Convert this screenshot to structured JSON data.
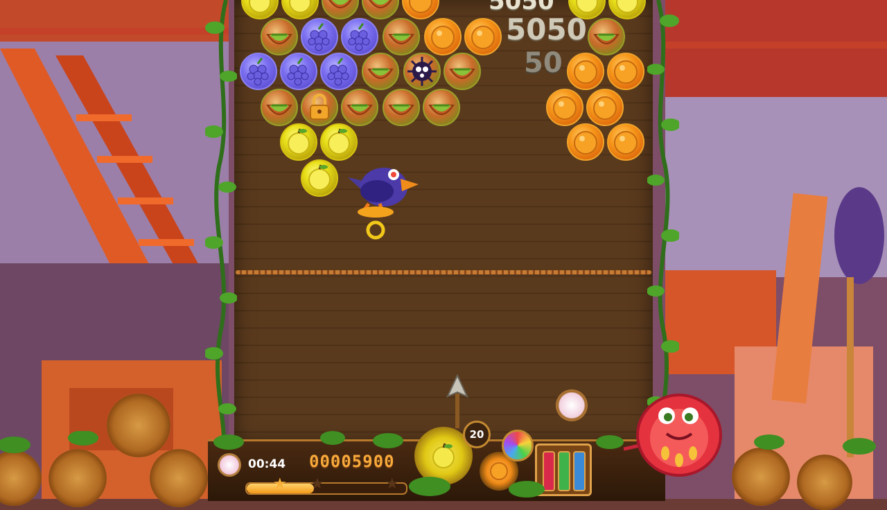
{
  "game": {
    "timer_text": "00:44",
    "score_text": "00005900",
    "shots_left": "20",
    "level_progress": 0.42,
    "stars_total": 3,
    "stars_earned": 1
  },
  "popups": {
    "top_points": "5050",
    "big_points": "5050",
    "small_points": "50"
  },
  "bubbles": {
    "shooter_fruit": "apple",
    "next_fruit": "orange",
    "types": [
      "apple",
      "orange",
      "grape",
      "melon",
      "locked",
      "spiky-bomb"
    ]
  },
  "colors": {
    "wood": "#5a3a1d",
    "accent_orange": "#f7a93a",
    "vine_green": "#3f8f22",
    "tube_red": "#d8294a",
    "tube_green": "#3fb24a",
    "tube_blue": "#3a8ad8"
  },
  "icons": [
    "clock-icon",
    "gauge-icon",
    "arrow-aim-icon",
    "crow-enemy-icon",
    "tomato-mascot-icon",
    "gear-icon",
    "padlock-icon",
    "star-icon"
  ]
}
